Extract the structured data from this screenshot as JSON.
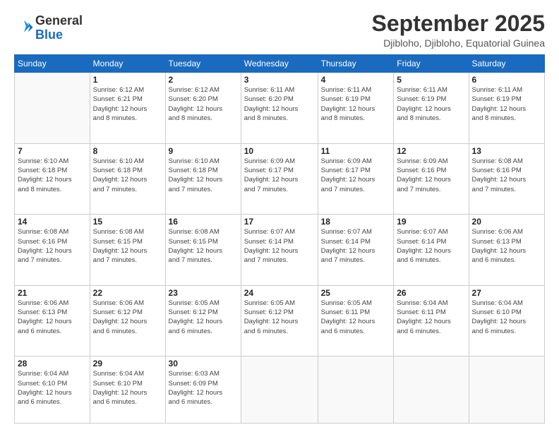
{
  "header": {
    "logo_general": "General",
    "logo_blue": "Blue",
    "month_title": "September 2025",
    "subtitle": "Djibloho, Djibloho, Equatorial Guinea"
  },
  "calendar": {
    "days_of_week": [
      "Sunday",
      "Monday",
      "Tuesday",
      "Wednesday",
      "Thursday",
      "Friday",
      "Saturday"
    ],
    "weeks": [
      [
        {
          "day": "",
          "info": ""
        },
        {
          "day": "1",
          "info": "Sunrise: 6:12 AM\nSunset: 6:21 PM\nDaylight: 12 hours\nand 8 minutes."
        },
        {
          "day": "2",
          "info": "Sunrise: 6:12 AM\nSunset: 6:20 PM\nDaylight: 12 hours\nand 8 minutes."
        },
        {
          "day": "3",
          "info": "Sunrise: 6:11 AM\nSunset: 6:20 PM\nDaylight: 12 hours\nand 8 minutes."
        },
        {
          "day": "4",
          "info": "Sunrise: 6:11 AM\nSunset: 6:19 PM\nDaylight: 12 hours\nand 8 minutes."
        },
        {
          "day": "5",
          "info": "Sunrise: 6:11 AM\nSunset: 6:19 PM\nDaylight: 12 hours\nand 8 minutes."
        },
        {
          "day": "6",
          "info": "Sunrise: 6:11 AM\nSunset: 6:19 PM\nDaylight: 12 hours\nand 8 minutes."
        }
      ],
      [
        {
          "day": "7",
          "info": "Sunrise: 6:10 AM\nSunset: 6:18 PM\nDaylight: 12 hours\nand 8 minutes."
        },
        {
          "day": "8",
          "info": "Sunrise: 6:10 AM\nSunset: 6:18 PM\nDaylight: 12 hours\nand 7 minutes."
        },
        {
          "day": "9",
          "info": "Sunrise: 6:10 AM\nSunset: 6:18 PM\nDaylight: 12 hours\nand 7 minutes."
        },
        {
          "day": "10",
          "info": "Sunrise: 6:09 AM\nSunset: 6:17 PM\nDaylight: 12 hours\nand 7 minutes."
        },
        {
          "day": "11",
          "info": "Sunrise: 6:09 AM\nSunset: 6:17 PM\nDaylight: 12 hours\nand 7 minutes."
        },
        {
          "day": "12",
          "info": "Sunrise: 6:09 AM\nSunset: 6:16 PM\nDaylight: 12 hours\nand 7 minutes."
        },
        {
          "day": "13",
          "info": "Sunrise: 6:08 AM\nSunset: 6:16 PM\nDaylight: 12 hours\nand 7 minutes."
        }
      ],
      [
        {
          "day": "14",
          "info": "Sunrise: 6:08 AM\nSunset: 6:16 PM\nDaylight: 12 hours\nand 7 minutes."
        },
        {
          "day": "15",
          "info": "Sunrise: 6:08 AM\nSunset: 6:15 PM\nDaylight: 12 hours\nand 7 minutes."
        },
        {
          "day": "16",
          "info": "Sunrise: 6:08 AM\nSunset: 6:15 PM\nDaylight: 12 hours\nand 7 minutes."
        },
        {
          "day": "17",
          "info": "Sunrise: 6:07 AM\nSunset: 6:14 PM\nDaylight: 12 hours\nand 7 minutes."
        },
        {
          "day": "18",
          "info": "Sunrise: 6:07 AM\nSunset: 6:14 PM\nDaylight: 12 hours\nand 7 minutes."
        },
        {
          "day": "19",
          "info": "Sunrise: 6:07 AM\nSunset: 6:14 PM\nDaylight: 12 hours\nand 6 minutes."
        },
        {
          "day": "20",
          "info": "Sunrise: 6:06 AM\nSunset: 6:13 PM\nDaylight: 12 hours\nand 6 minutes."
        }
      ],
      [
        {
          "day": "21",
          "info": "Sunrise: 6:06 AM\nSunset: 6:13 PM\nDaylight: 12 hours\nand 6 minutes."
        },
        {
          "day": "22",
          "info": "Sunrise: 6:06 AM\nSunset: 6:12 PM\nDaylight: 12 hours\nand 6 minutes."
        },
        {
          "day": "23",
          "info": "Sunrise: 6:05 AM\nSunset: 6:12 PM\nDaylight: 12 hours\nand 6 minutes."
        },
        {
          "day": "24",
          "info": "Sunrise: 6:05 AM\nSunset: 6:12 PM\nDaylight: 12 hours\nand 6 minutes."
        },
        {
          "day": "25",
          "info": "Sunrise: 6:05 AM\nSunset: 6:11 PM\nDaylight: 12 hours\nand 6 minutes."
        },
        {
          "day": "26",
          "info": "Sunrise: 6:04 AM\nSunset: 6:11 PM\nDaylight: 12 hours\nand 6 minutes."
        },
        {
          "day": "27",
          "info": "Sunrise: 6:04 AM\nSunset: 6:10 PM\nDaylight: 12 hours\nand 6 minutes."
        }
      ],
      [
        {
          "day": "28",
          "info": "Sunrise: 6:04 AM\nSunset: 6:10 PM\nDaylight: 12 hours\nand 6 minutes."
        },
        {
          "day": "29",
          "info": "Sunrise: 6:04 AM\nSunset: 6:10 PM\nDaylight: 12 hours\nand 6 minutes."
        },
        {
          "day": "30",
          "info": "Sunrise: 6:03 AM\nSunset: 6:09 PM\nDaylight: 12 hours\nand 6 minutes."
        },
        {
          "day": "",
          "info": ""
        },
        {
          "day": "",
          "info": ""
        },
        {
          "day": "",
          "info": ""
        },
        {
          "day": "",
          "info": ""
        }
      ]
    ]
  }
}
